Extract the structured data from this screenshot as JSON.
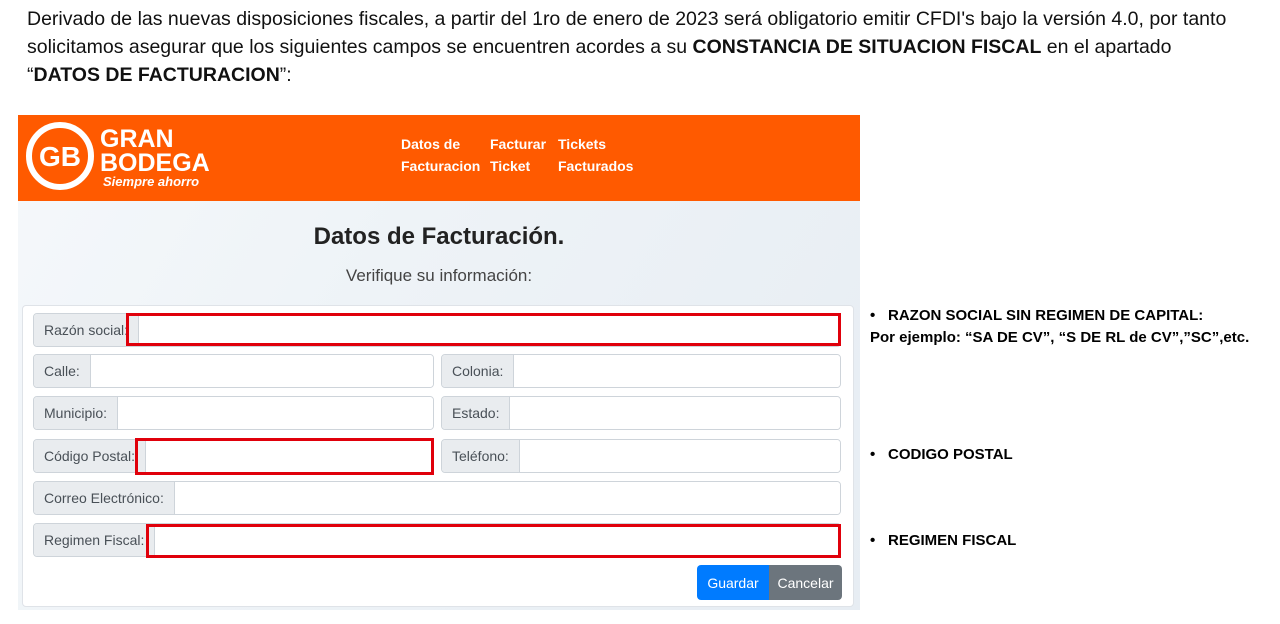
{
  "intro": {
    "part1": "Derivado de las nuevas disposiciones fiscales, a partir del 1ro de enero de 2023 será obligatorio emitir CFDI's bajo la versión 4.0, por tanto solicitamos asegurar que los siguientes campos se encuentren acordes a su ",
    "bold1": "CONSTANCIA DE SITUACION FISCAL",
    "part2": " en el apartado “",
    "bold2": "DATOS DE FACTURACION",
    "part3": "”:"
  },
  "brand": {
    "line1": "GRAN",
    "line2": "BODEGA",
    "tagline": "Siempre ahorro",
    "mark": "GB",
    "color": "#ff5a00"
  },
  "nav": [
    {
      "line1": "Datos de",
      "line2": "Facturacion"
    },
    {
      "line1": "Facturar",
      "line2": "Ticket"
    },
    {
      "line1": "Tickets",
      "line2": "Facturados"
    }
  ],
  "form": {
    "title": "Datos de Facturación.",
    "subtitle": "Verifique su información:",
    "razon_social": "Razón social:",
    "calle": "Calle:",
    "colonia": "Colonia:",
    "municipio": "Municipio:",
    "estado": "Estado:",
    "codigo_postal": "Código Postal:",
    "telefono": "Teléfono:",
    "correo": "Correo Electrónico:",
    "regimen": "Regimen Fiscal:",
    "save": "Guardar",
    "cancel": "Cancelar"
  },
  "notes": {
    "bullet": "•",
    "razon_line1": "RAZON SOCIAL SIN REGIMEN DE CAPITAL:",
    "razon_line2": "Por ejemplo: “SA DE CV”, “S DE RL de  CV”,”SC”,etc.",
    "cp": "CODIGO POSTAL",
    "regimen": "REGIMEN FISCAL"
  },
  "colors": {
    "highlight": "#e0000b",
    "primary": "#007bff",
    "secondary": "#6c757d"
  }
}
